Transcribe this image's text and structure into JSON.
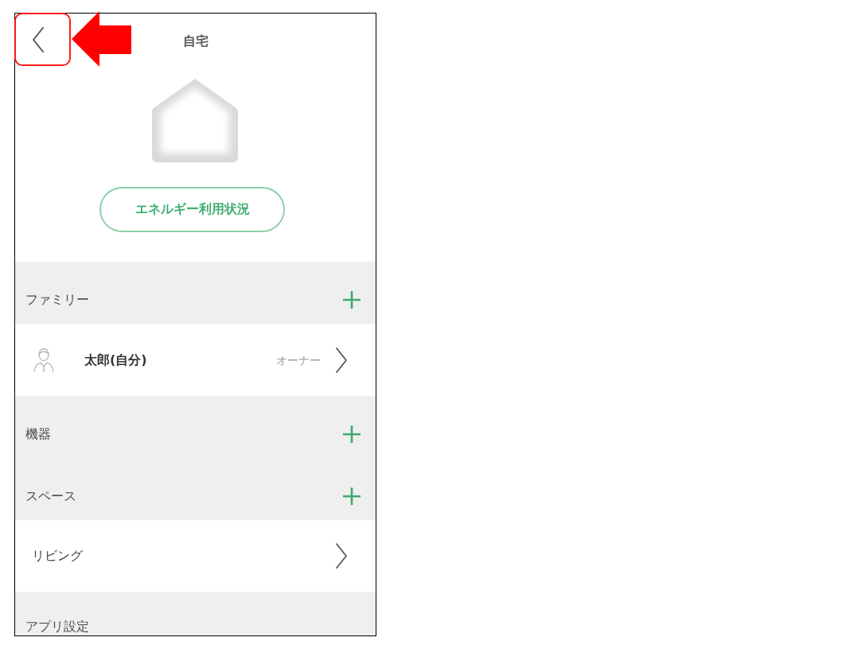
{
  "header": {
    "back_button": {
      "highlighted": true,
      "callout_arrow": true
    },
    "title": "自宅"
  },
  "energy_button": {
    "label": "エネルギー利用状況"
  },
  "sections": [
    {
      "title": "ファミリー",
      "add_button": true,
      "items": [
        {
          "kind": "member",
          "name": "太郎(自分)",
          "role": "オーナー"
        }
      ]
    },
    {
      "title": "機器",
      "add_button": true
    },
    {
      "title": "スペース",
      "add_button": true,
      "items": [
        {
          "kind": "space",
          "name": "リビング"
        }
      ]
    },
    {
      "title": "アプリ設定",
      "add_button": false
    }
  ]
}
